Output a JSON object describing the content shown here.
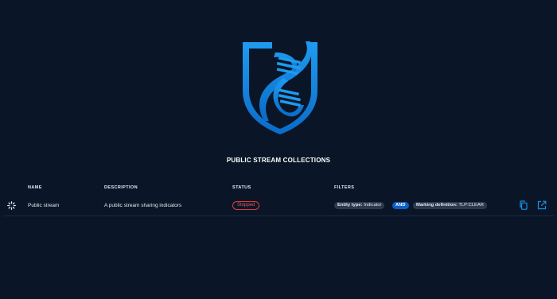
{
  "page": {
    "title": "PUBLIC STREAM COLLECTIONS"
  },
  "table": {
    "headers": {
      "name": "NAME",
      "description": "DESCRIPTION",
      "status": "STATUS",
      "filters": "FILTERS"
    },
    "rows": [
      {
        "name": "Public stream",
        "description": "A public stream sharing indicators",
        "status": "Stopped",
        "filters": {
          "first": {
            "key": "Entity type:",
            "value": "Indicator"
          },
          "operator": "AND",
          "second": {
            "key": "Marking definition:",
            "value": "TLP:CLEAR"
          }
        }
      }
    ]
  },
  "icons": {
    "row": "stream-icon",
    "copy": "copy-icon",
    "open": "open-in-new-icon",
    "logo": "dna-shield-logo"
  },
  "colors": {
    "background": "#0a1628",
    "accent": "#1a8fe8",
    "status_stopped": "#e03a3a",
    "and_chip": "#0e5fc4",
    "chip": "#2d3a4e"
  }
}
